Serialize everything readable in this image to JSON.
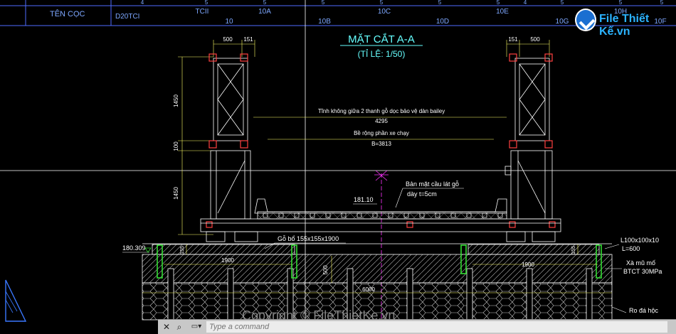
{
  "header": {
    "row_label": "TÊN CỌC",
    "row_value": "D20TCI",
    "top_digits": [
      "4",
      "5",
      "5",
      "5",
      "5",
      "5",
      "5",
      "4",
      "5",
      "5",
      "5"
    ],
    "piles_upper": [
      "TCII",
      "10A",
      "10C",
      "10E",
      "10H"
    ],
    "piles_lower": [
      "10",
      "10B",
      "10D",
      "10G",
      "10F"
    ]
  },
  "drawing": {
    "title": "MẶT CẮT A-A",
    "scale": "(TỈ LỆ: 1/50)",
    "clearance_text": "Tĩnh không giữa 2 thanh gỗ dọc bảo vệ dàn bailey",
    "clearance_value": "4295",
    "road_width_text": "Bề rộng phần xe chạy",
    "road_width_value": "B=3813",
    "deck_text_1": "Bản mặt cầu lát gỗ",
    "deck_text_2": "dày t=5cm",
    "elev_deck": "181.10",
    "elev_ground": "180.309",
    "dims": {
      "top_a": "500",
      "top_b": "151",
      "top_c": "151",
      "top_d": "500",
      "h1": "1450",
      "h2": "100",
      "h3": "1450",
      "sleeper_w_left": "1900",
      "sleeper_w_right": "1900",
      "sleeper_h_left": "155",
      "sleeper_h_right": "155",
      "pile_cap_h": "500",
      "cap_width": "6000"
    },
    "notes": {
      "timber_block": "Gỗ bổ 155x155x1900",
      "angle_1": "L100x100x10",
      "angle_2": "L=600",
      "abutment_1": "Xà mũ mố",
      "abutment_2": "BTCT 30MPa",
      "rubble": "Ro đá hộc"
    }
  },
  "command_line": {
    "placeholder": "Type a command"
  },
  "logo": {
    "text": "File Thiết Kế.vn"
  },
  "watermark": {
    "text": "Copyright © FileThietKe.vn"
  },
  "colors": {
    "frame": "#ffffff",
    "dimension": "#ffff66",
    "text": "#ffffff",
    "header": "#7da7ff",
    "title": "#66ffff",
    "red": "#ff4040",
    "green": "#33dd33",
    "magenta": "#ff33ff",
    "accent": "#2bb3ff"
  }
}
